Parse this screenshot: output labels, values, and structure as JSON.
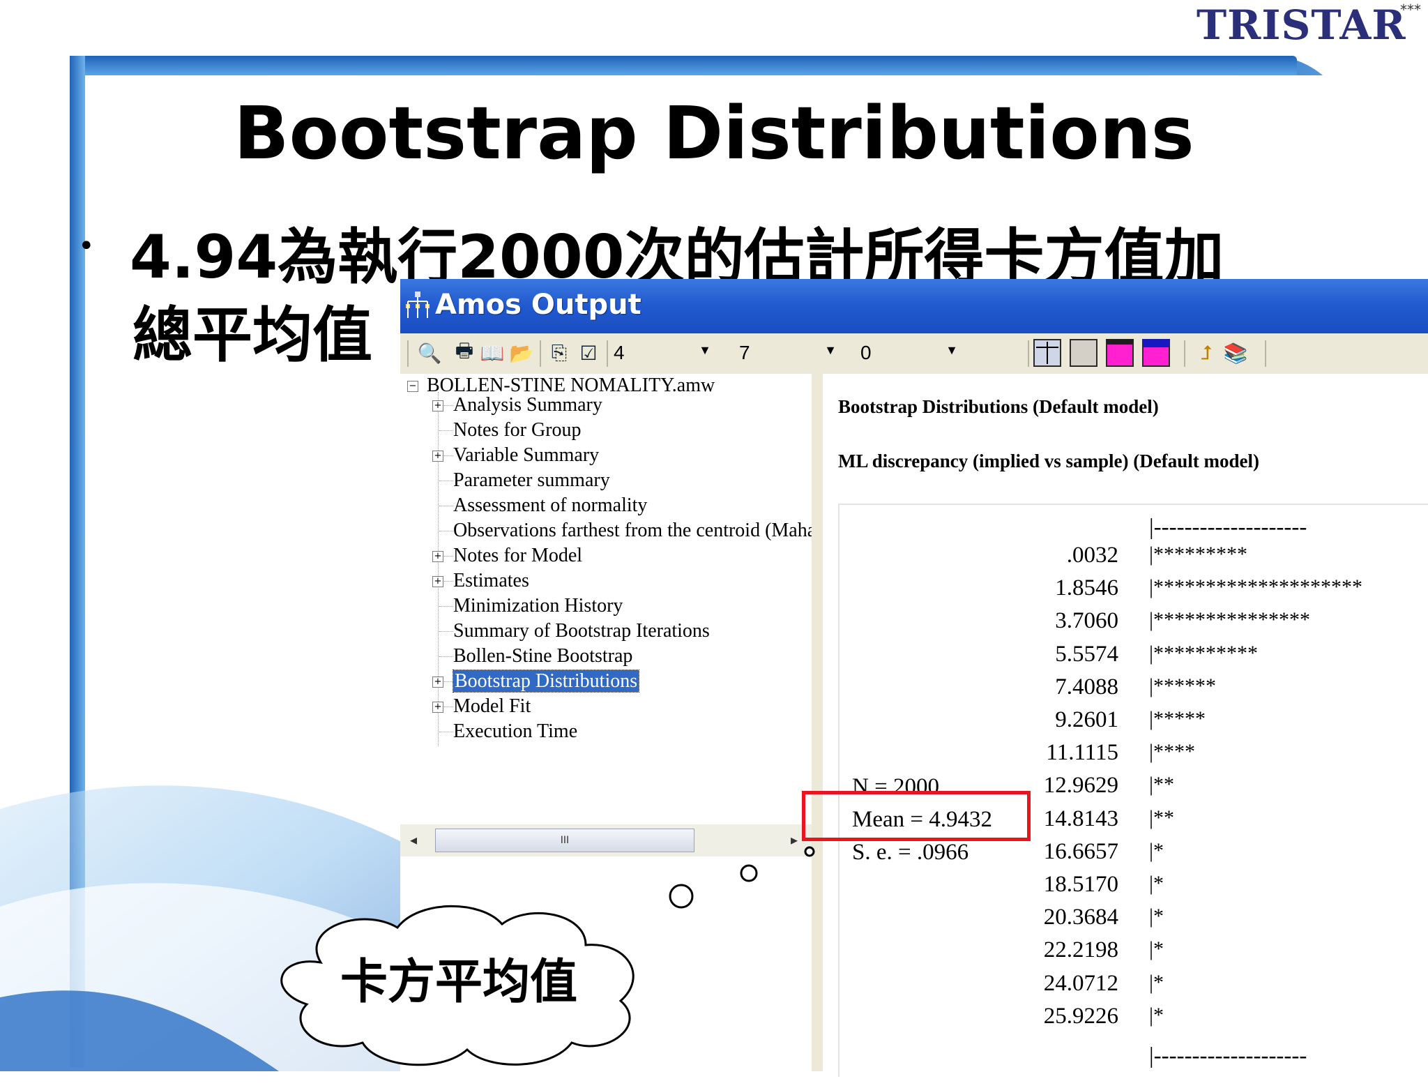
{
  "slide": {
    "logo": "TRISTAR",
    "logo_mark": "***",
    "title": "Bootstrap Distributions",
    "bullet_line1": "4.94為執行2000次的估計所得卡方值加",
    "bullet_line2": "總平均值",
    "callout": "卡方平均值"
  },
  "window": {
    "title": "Amos Output",
    "title_icon": "amos-tree-icon",
    "toolbar": {
      "icons": [
        "print-preview-icon",
        "print-icon",
        "book-icon",
        "open-folder-icon",
        "copy-icon",
        "check-icon"
      ],
      "combo1": "4",
      "combo2": "7",
      "combo3": "0",
      "right_icons": [
        "grid-cross-icon",
        "grid-square-icon",
        "magenta-table-icon",
        "magenta-blue-table-icon",
        "up-arrow-icon",
        "help-book-icon"
      ]
    }
  },
  "tree": {
    "root": "BOLLEN-STINE NOMALITY.amw",
    "items": [
      {
        "label": "Analysis Summary",
        "expandable": true
      },
      {
        "label": "Notes for Group",
        "expandable": false
      },
      {
        "label": "Variable Summary",
        "expandable": true
      },
      {
        "label": "Parameter summary",
        "expandable": false
      },
      {
        "label": "Assessment of normality",
        "expandable": false
      },
      {
        "label": "Observations farthest from the centroid (Mahal",
        "expandable": false
      },
      {
        "label": "Notes for Model",
        "expandable": true
      },
      {
        "label": "Estimates",
        "expandable": true
      },
      {
        "label": "Minimization History",
        "expandable": false
      },
      {
        "label": "Summary of Bootstrap Iterations",
        "expandable": false
      },
      {
        "label": "Bollen-Stine Bootstrap",
        "expandable": false
      },
      {
        "label": "Bootstrap Distributions",
        "expandable": true,
        "selected": true
      },
      {
        "label": "Model Fit",
        "expandable": true
      },
      {
        "label": "Execution Time",
        "expandable": false
      }
    ],
    "scroll_thumb_grip": "III"
  },
  "output": {
    "heading": "Bootstrap Distributions (Default model)",
    "subheading": "ML discrepancy (implied vs sample) (Default model)",
    "dash_top": "|--------------------",
    "dash_bottom": "|--------------------",
    "bins": [
      {
        "value": ".0032",
        "bar": "|*********"
      },
      {
        "value": "1.8546",
        "bar": "|********************"
      },
      {
        "value": "3.7060",
        "bar": "|***************"
      },
      {
        "value": "5.5574",
        "bar": "|**********"
      },
      {
        "value": "7.4088",
        "bar": "|******"
      },
      {
        "value": "9.2601",
        "bar": "|*****"
      },
      {
        "value": "11.1115",
        "bar": "|****"
      },
      {
        "value": "12.9629",
        "bar": "|**"
      },
      {
        "value": "14.8143",
        "bar": "|**"
      },
      {
        "value": "16.6657",
        "bar": "|*"
      },
      {
        "value": "18.5170",
        "bar": "|*"
      },
      {
        "value": "20.3684",
        "bar": "|*"
      },
      {
        "value": "22.2198",
        "bar": "|*"
      },
      {
        "value": "24.0712",
        "bar": "|*"
      },
      {
        "value": "25.9226",
        "bar": "|*"
      }
    ],
    "stats": {
      "n": "N = 2000",
      "mean": "Mean = 4.9432",
      "se": "S. e. = .0966"
    }
  },
  "colors": {
    "highlight_box": "#e8151d",
    "titlebar": "#2159cf",
    "selection": "#316ac5"
  }
}
